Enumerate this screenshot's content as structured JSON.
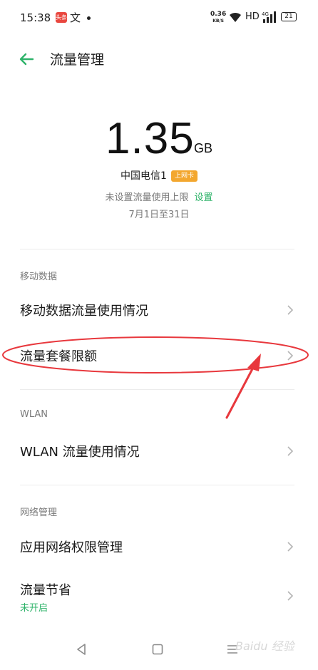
{
  "status_bar": {
    "time": "15:38",
    "app_icon_text": "头条",
    "text_icon": "文",
    "net_speed": "0.36",
    "net_speed_unit": "KB/S",
    "hd": "HD",
    "signal": "4G",
    "battery": "21"
  },
  "header": {
    "title": "流量管理"
  },
  "usage": {
    "value": "1.35",
    "unit": "GB",
    "sim_name": "中国电信1",
    "sim_badge": "上网卡",
    "limit_text": "未设置流量使用上限",
    "limit_link": "设置",
    "period": "7月1日至31日"
  },
  "sections": {
    "mobile_data": {
      "title": "移动数据",
      "items": [
        {
          "label": "移动数据流量使用情况"
        },
        {
          "label": "流量套餐限额"
        }
      ]
    },
    "wlan": {
      "title": "WLAN",
      "items": [
        {
          "label": "WLAN 流量使用情况"
        }
      ]
    },
    "network": {
      "title": "网络管理",
      "items": [
        {
          "label": "应用网络权限管理"
        },
        {
          "label": "流量节省",
          "sub": "未开启"
        }
      ]
    }
  },
  "watermark": "Baidu 经验",
  "colors": {
    "accent": "#2fb36a",
    "badge": "#f3a72f",
    "annotation": "#e8383d"
  }
}
